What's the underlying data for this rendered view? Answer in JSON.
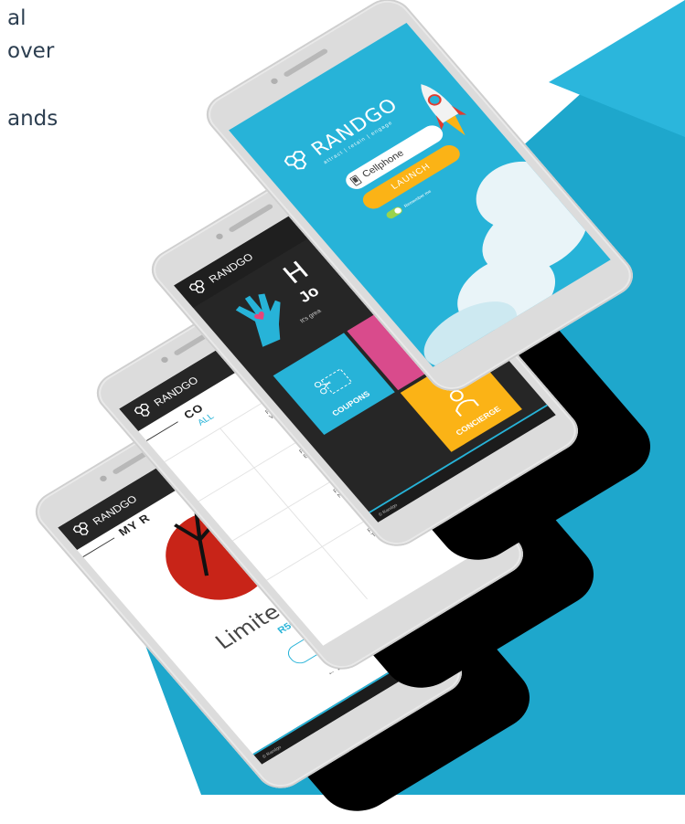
{
  "intro": {
    "line1": "al",
    "line2": "over",
    "line3": "",
    "line4": "ands"
  },
  "colors": {
    "accent": "#27b3d8",
    "launch": "#fbb316",
    "background_band": "#1ea7cc",
    "dark_panel": "#262626"
  },
  "login_screen": {
    "brand": "RANDGO",
    "tagline": "attract | retain | engage",
    "cellphone_placeholder": "Cellphone",
    "launch_label": "LAUNCH",
    "remember_label": "Remember me",
    "phone_icon": "cellphone-icon"
  },
  "home_screen": {
    "brand": "RANDGO",
    "greeting_big": "H",
    "greeting_name": "Jo",
    "subtitle": "It's grea",
    "coupons_label": "COUPONS",
    "concierge_label": "CONCIERGE",
    "footer": "© Randgo"
  },
  "coupons_screen": {
    "brand": "RANDGO",
    "title": "CO",
    "tab_all": "ALL",
    "rows": [
      {
        "line1": "R5",
        "line2": "W"
      },
      {
        "line1": "R5",
        "line2": "Ba"
      },
      {
        "line1": "R1",
        "line2": "Ne"
      },
      {
        "line1": "R2",
        "line2": "Ta"
      }
    ]
  },
  "rewards_screen": {
    "brand": "RANDGO",
    "title": "MY R",
    "product": "Limite",
    "price": "R50",
    "get_label": "GE",
    "back_label": "← B",
    "footer": "© Randgo"
  }
}
